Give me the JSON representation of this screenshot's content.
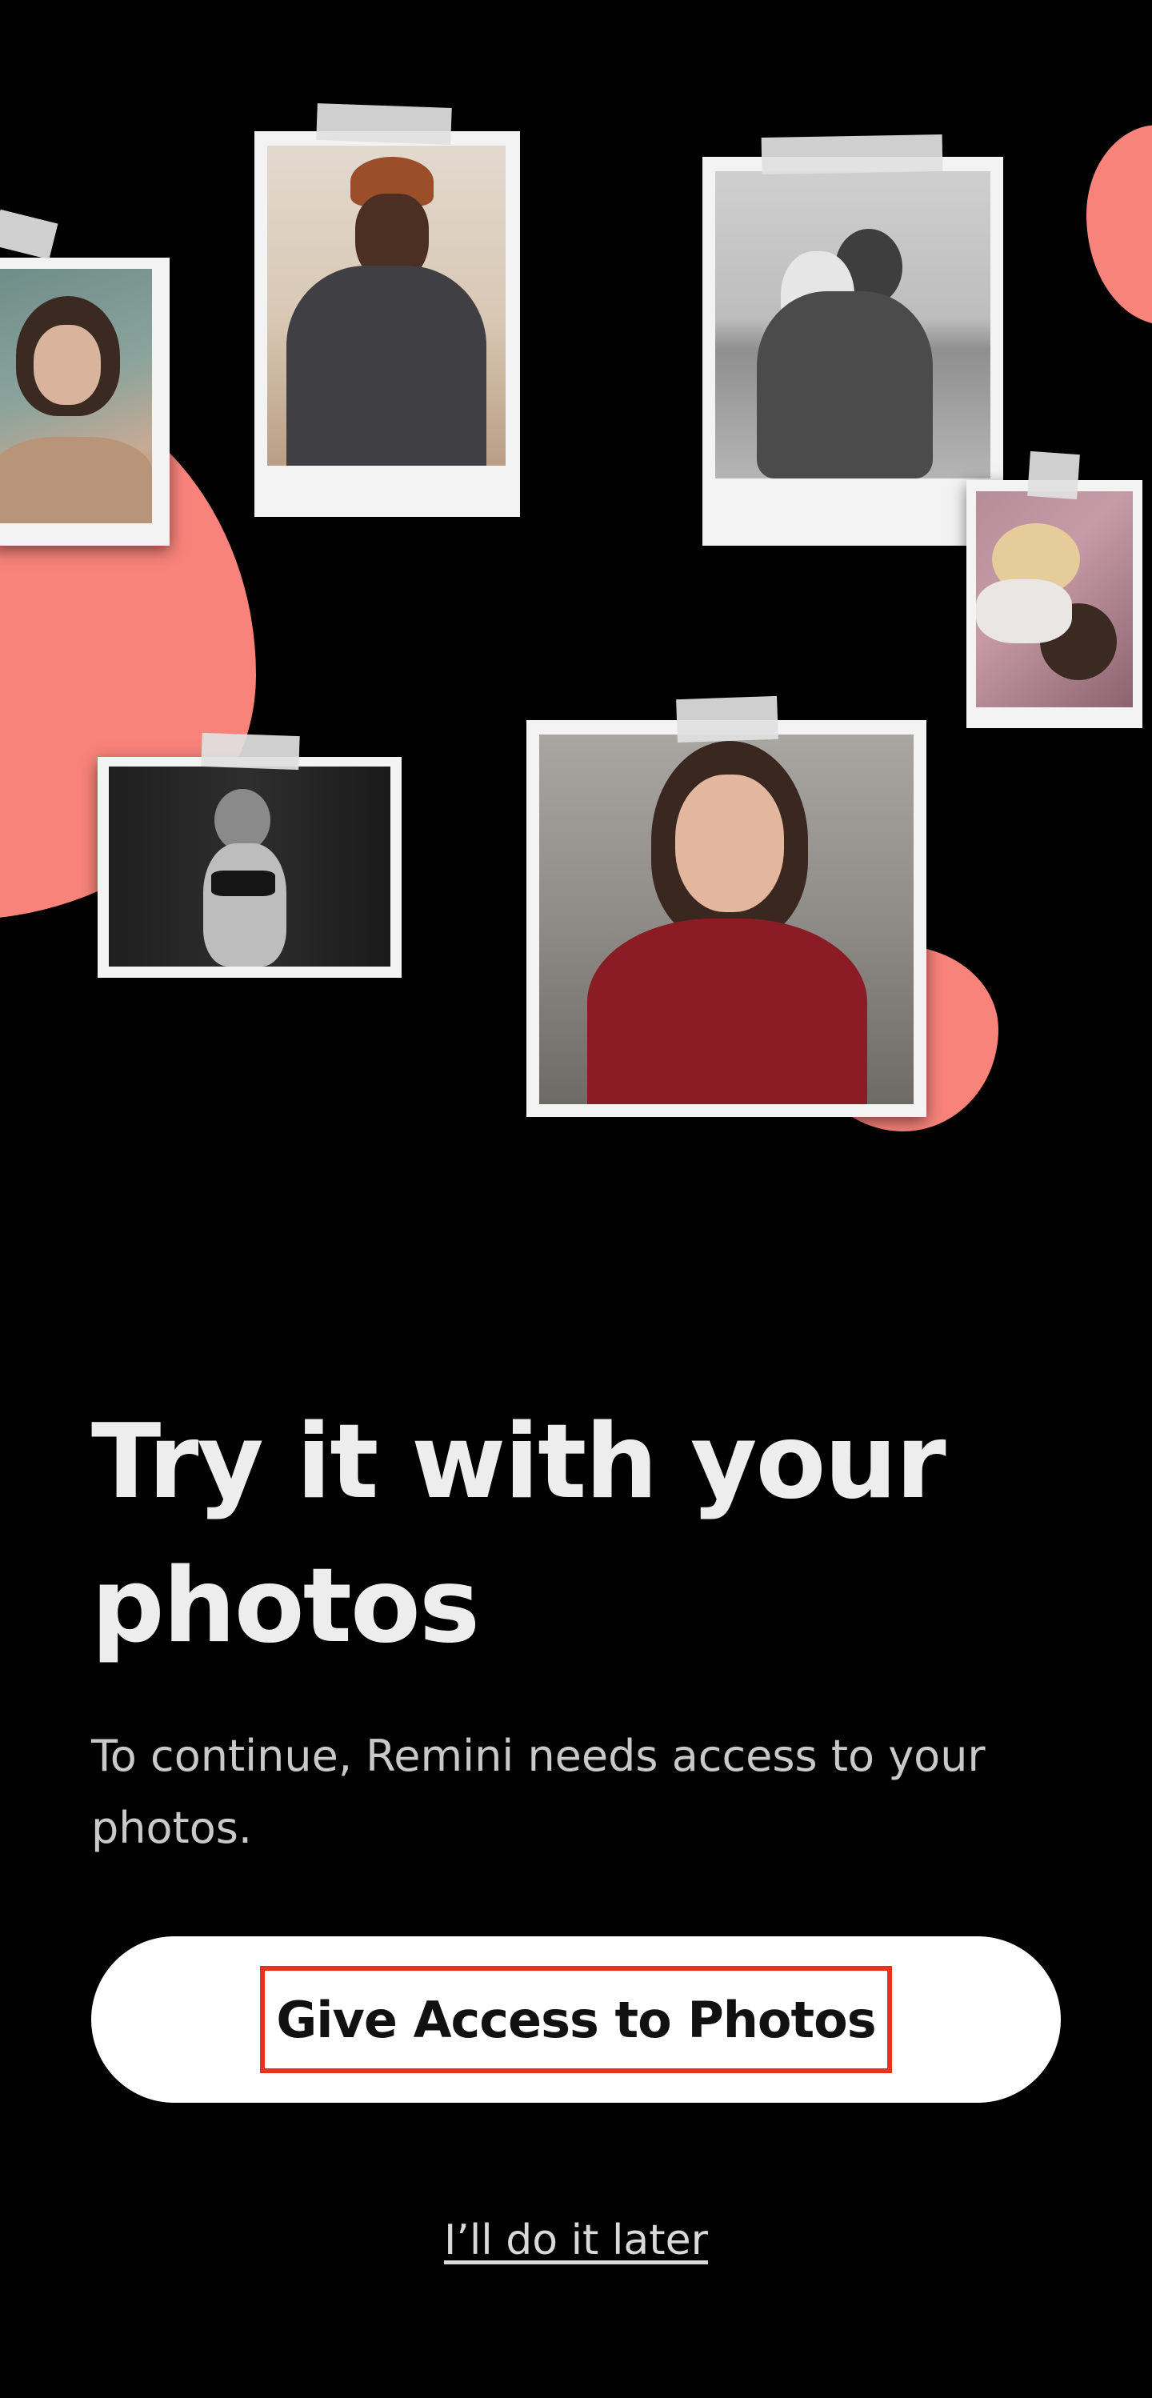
{
  "onboarding": {
    "title": "Try it with your photos",
    "subtitle": "To continue, Remini needs access to your photos.",
    "primary_button_label": "Give Access to Photos",
    "secondary_link_label": "I’ll do it later"
  },
  "collage": {
    "photos": [
      "portrait-woman-flowers",
      "man-orange-beanie-beach",
      "father-baby-beach-bw",
      "two-people-lying-down",
      "woman-dancing-bw",
      "smiling-woman-red-sweater"
    ]
  },
  "colors": {
    "background": "#000000",
    "accent_blob": "#F7837A",
    "button_background": "#FFFFFF",
    "highlight_border": "#E8321E"
  }
}
